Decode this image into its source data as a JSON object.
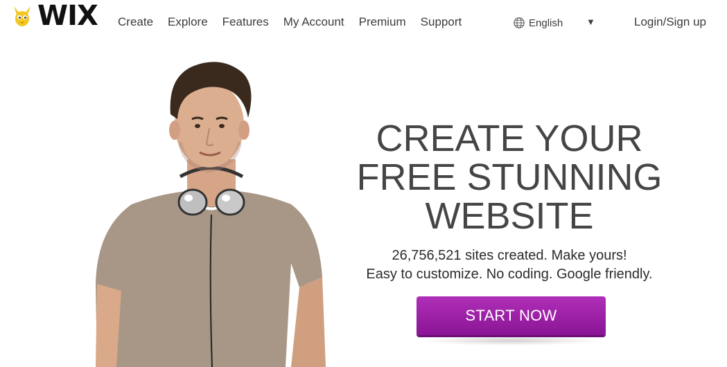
{
  "brand": {
    "logo_text": "WIX",
    "accent_color": "#9a1fa5",
    "logo_icon": "yellow-mascot-icon"
  },
  "nav": {
    "items": [
      {
        "label": "Create"
      },
      {
        "label": "Explore"
      },
      {
        "label": "Features"
      },
      {
        "label": "My Account"
      },
      {
        "label": "Premium"
      },
      {
        "label": "Support"
      }
    ],
    "language": "English",
    "language_icon": "globe-icon",
    "language_arrow": "▼",
    "login": "Login/Sign up"
  },
  "hero": {
    "headline": [
      "CREATE YOUR",
      "FREE STUNNING",
      "WEBSITE"
    ],
    "sub": [
      "26,756,521 sites created. Make yours!",
      "Easy to customize. No coding. Google friendly."
    ],
    "cta": "START NOW",
    "image": "man-with-headphones-photo"
  }
}
